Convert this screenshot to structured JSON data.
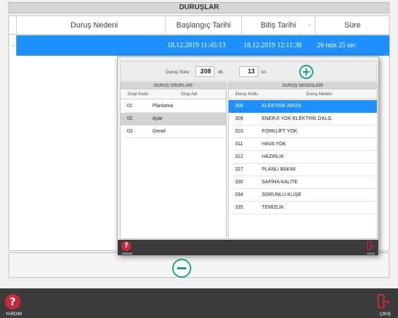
{
  "window": {
    "title": "DURUŞLAR"
  },
  "grid": {
    "columns": [
      "Duruş Nedeni",
      "Başlangıç Tarihi",
      "Bitiş Tarihi",
      "Süre"
    ],
    "rows": [
      {
        "indicator": "→",
        "reason": "",
        "start": "18.12.2019 11:45:13",
        "end": "18.12.2019 12:11:38",
        "duration": "26 min 25 sec"
      }
    ]
  },
  "popup": {
    "duration": {
      "label": "Duruş Süre",
      "minutes": "208",
      "minutes_unit": "dk.",
      "seconds": "13",
      "seconds_unit": "sn."
    },
    "groups": {
      "title": "DURUŞ GRUPLARI",
      "columns": [
        "Grup Kodu",
        "Grup Adı"
      ],
      "rows": [
        {
          "indicator": "",
          "code": "01",
          "name": "Planlama"
        },
        {
          "indicator": "→",
          "code": "02",
          "name": "Ayar"
        },
        {
          "indicator": "",
          "code": "03",
          "name": "Genel"
        }
      ]
    },
    "reasons": {
      "title": "DURUŞ NEDENLERİ",
      "columns": [
        "Duruş Kodu",
        "Duruş Nedeni"
      ],
      "rows": [
        {
          "indicator": "→",
          "code": "308",
          "name": "ELEKTRİK ARIZA"
        },
        {
          "indicator": "",
          "code": "309",
          "name": "ENERJİ YOK-ELEKTRİK DALG."
        },
        {
          "indicator": "",
          "code": "310",
          "name": "FORKLİFT YOK"
        },
        {
          "indicator": "",
          "code": "311",
          "name": "HAVA YOK"
        },
        {
          "indicator": "",
          "code": "312",
          "name": "HAZIRLIK"
        },
        {
          "indicator": "",
          "code": "327",
          "name": "PLANLI BAKIM"
        },
        {
          "indicator": "",
          "code": "330",
          "name": "SAFİHA KALİTE"
        },
        {
          "indicator": "",
          "code": "334",
          "name": "SORUNLU KLİŞE"
        },
        {
          "indicator": "",
          "code": "335",
          "name": "TEMİZLİK"
        }
      ]
    },
    "footer": {
      "help_label": "YARDIM",
      "exit_label": "ÇIKIŞ"
    }
  },
  "footer": {
    "help_label": "YARDIM",
    "exit_label": "ÇIKIŞ"
  },
  "icons": {
    "help": "question-mark-icon",
    "exit": "exit-door-icon",
    "add": "plus-circle-icon",
    "remove": "minus-circle-icon"
  },
  "colors": {
    "selection": "#1e90ff",
    "accent_teal": "#1aa18a",
    "help_red": "#c8293a",
    "footer_bg": "#3b3b3b"
  }
}
